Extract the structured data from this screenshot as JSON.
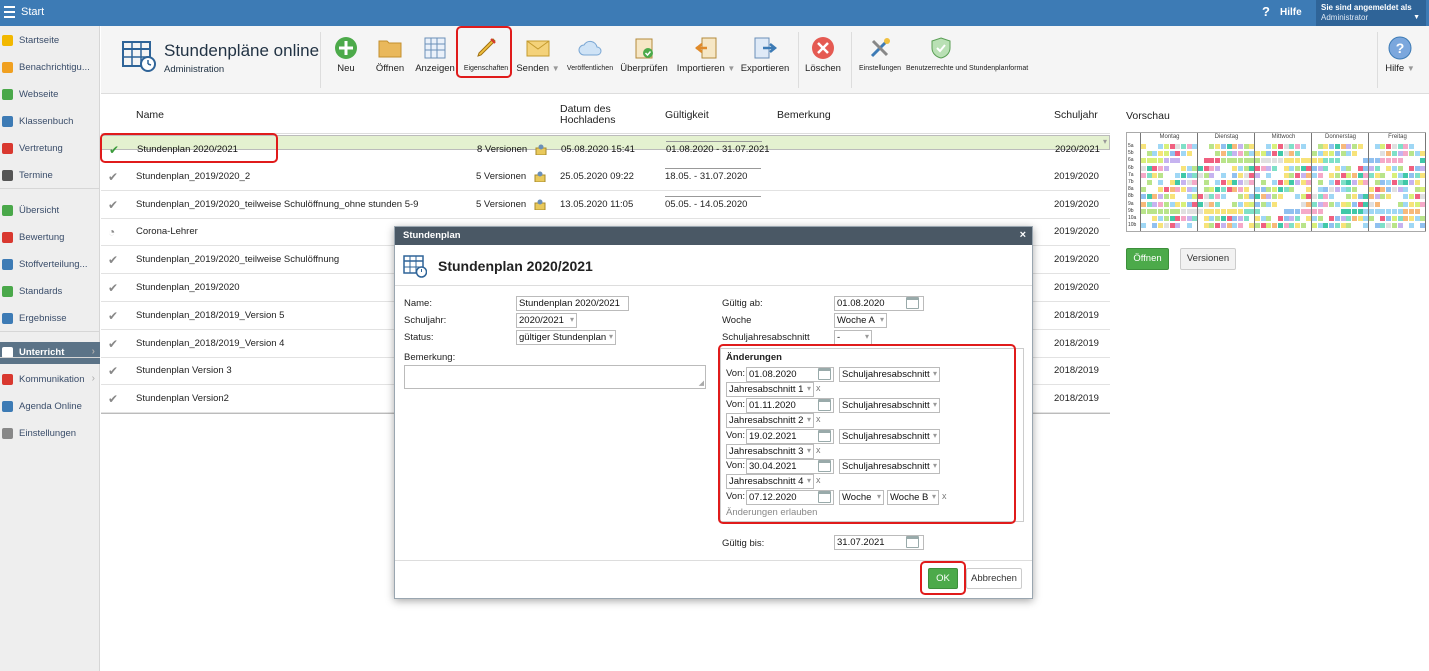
{
  "app": {
    "title": "Start",
    "help_label": "Hilfe",
    "user_line1": "Sie sind angemeldet als",
    "user_line2": "Administrator"
  },
  "sidebar": {
    "items": [
      {
        "label": "Startseite",
        "icon": "star-icon",
        "color": "#f2b800"
      },
      {
        "label": "Benachrichtigu...",
        "icon": "envelope-icon",
        "color": "#f0a020"
      },
      {
        "label": "Webseite",
        "icon": "house-icon",
        "color": "#4aa84a"
      },
      {
        "label": "Klassenbuch",
        "icon": "book-icon",
        "color": "#3d7bb5"
      },
      {
        "label": "Vertretung",
        "icon": "person-icon",
        "color": "#d9382f"
      },
      {
        "label": "Termine",
        "icon": "calendar-icon",
        "color": "#555"
      },
      {
        "label": "Übersicht",
        "icon": "check-circle-icon",
        "color": "#4aa84a"
      },
      {
        "label": "Bewertung",
        "icon": "rating-icon",
        "color": "#d9382f"
      },
      {
        "label": "Stoffverteilung...",
        "icon": "books-icon",
        "color": "#3d7bb5"
      },
      {
        "label": "Standards",
        "icon": "shield-icon",
        "color": "#4aa84a"
      },
      {
        "label": "Ergebnisse",
        "icon": "bar-chart-icon",
        "color": "#3d7bb5"
      },
      {
        "label": "Unterricht",
        "icon": "open-book-icon",
        "color": "#fff"
      },
      {
        "label": "Kommunikation",
        "icon": "chat-icon",
        "color": "#d9382f"
      },
      {
        "label": "Agenda Online",
        "icon": "pen-icon",
        "color": "#3d7bb5"
      },
      {
        "label": "Einstellungen",
        "icon": "gear-icon",
        "color": "#888"
      }
    ]
  },
  "toolbar": {
    "title": "Stundenpläne online",
    "subtitle": "Administration",
    "buttons": {
      "new": "Neu",
      "open": "Öffnen",
      "show": "Anzeigen",
      "properties": "Eigenschaften",
      "send": "Senden",
      "publish": "Veröffentlichen",
      "check": "Überprüfen",
      "import": "Importieren",
      "export": "Exportieren",
      "delete": "Löschen",
      "settings": "Einstellungen",
      "rights": "Benutzerrechte und Stundenplanformat",
      "help": "Hilfe"
    }
  },
  "list": {
    "headers": {
      "name": "Name",
      "upload_date": "Datum des Hochladens",
      "validity": "Gültigkeit",
      "remark": "Bemerkung",
      "school_year": "Schuljahr"
    },
    "rows": [
      {
        "name": "Stundenplan 2020/2021",
        "versions": "8 Versionen",
        "date": "05.08.2020 15:41",
        "validity": "01.08.2020 - 31.07.2021",
        "year": "2020/2021"
      },
      {
        "name": "Stundenplan_2019/2020_2",
        "versions": "5 Versionen",
        "date": "25.05.2020 09:22",
        "validity": "18.05. - 31.07.2020",
        "year": "2019/2020"
      },
      {
        "name": "Stundenplan_2019/2020_teilweise Schulöffnung_ohne stunden 5-9",
        "versions": "5 Versionen",
        "date": "13.05.2020 11:05",
        "validity": "05.05. - 14.05.2020",
        "year": "2019/2020"
      },
      {
        "name": "Corona-Lehrer",
        "versions": "",
        "date": "",
        "validity": "",
        "year": "2019/2020"
      },
      {
        "name": "Stundenplan_2019/2020_teilweise Schulöffnung",
        "versions": "",
        "date": "",
        "validity": "",
        "year": "2019/2020"
      },
      {
        "name": "Stundenplan_2019/2020",
        "versions": "",
        "date": "",
        "validity": "",
        "year": "2019/2020"
      },
      {
        "name": "Stundenplan_2018/2019_Version 5",
        "versions": "",
        "date": "",
        "validity": "",
        "year": "2018/2019"
      },
      {
        "name": "Stundenplan_2018/2019_Version 4",
        "versions": "",
        "date": "",
        "validity": "",
        "year": "2018/2019"
      },
      {
        "name": "Stundenplan Version 3",
        "versions": "",
        "date": "",
        "validity": "",
        "year": "2018/2019"
      },
      {
        "name": "Stundenplan Version2",
        "versions": "",
        "date": "",
        "validity": "",
        "year": "2018/2019"
      }
    ]
  },
  "preview": {
    "title": "Vorschau",
    "days": [
      "Montag",
      "Dienstag",
      "Mittwoch",
      "Donnerstag",
      "Freitag"
    ],
    "classes": [
      "5a",
      "5b",
      "6a",
      "6b",
      "7a",
      "7b",
      "8a",
      "8b",
      "9a",
      "9b",
      "10a",
      "10b"
    ],
    "open_button": "Öffnen",
    "versions_button": "Versionen"
  },
  "dialog": {
    "header": "Stundenplan",
    "title": "Stundenplan 2020/2021",
    "name_label": "Name:",
    "name_value": "Stundenplan 2020/2021",
    "year_label": "Schuljahr:",
    "year_value": "2020/2021",
    "status_label": "Status:",
    "status_value": "gültiger Stundenplan",
    "remark_label": "Bemerkung:",
    "valid_from_label": "Gültig ab:",
    "valid_from_value": "01.08.2020",
    "week_label": "Woche",
    "week_value": "Woche A",
    "section_label": "Schuljahresabschnitt",
    "section_value": "-",
    "changes_label": "Änderungen",
    "from_label": "Von:",
    "changes": [
      {
        "date": "01.08.2020",
        "type": "Schuljahresabschnitt",
        "value": "Jahresabschnitt 1"
      },
      {
        "date": "01.11.2020",
        "type": "Schuljahresabschnitt",
        "value": "Jahresabschnitt 2"
      },
      {
        "date": "19.02.2021",
        "type": "Schuljahresabschnitt",
        "value": "Jahresabschnitt 3"
      },
      {
        "date": "30.04.2021",
        "type": "Schuljahresabschnitt",
        "value": "Jahresabschnitt 4"
      },
      {
        "date": "07.12.2020",
        "type": "Woche",
        "value": "Woche B"
      }
    ],
    "remove_mark": "x",
    "allow_changes": "Änderungen erlauben",
    "valid_to_label": "Gültig bis:",
    "valid_to_value": "31.07.2021",
    "ok": "OK",
    "cancel": "Abbrechen",
    "close": "×"
  }
}
